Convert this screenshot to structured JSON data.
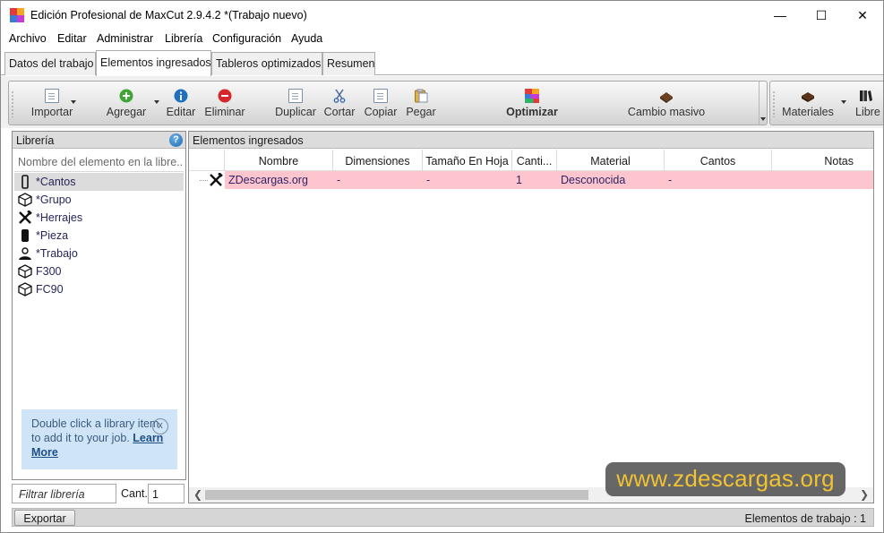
{
  "window": {
    "title": "Edición Profesional de MaxCut 2.9.4.2 *(Trabajo nuevo)",
    "minimize_glyph": "—",
    "maximize_glyph": "☐",
    "close_glyph": "✕"
  },
  "menu": [
    "Archivo",
    "Editar",
    "Administrar",
    "Librería",
    "Configuración",
    "Ayuda"
  ],
  "tabs": [
    {
      "label": "Datos del trabajo",
      "active": false
    },
    {
      "label": "Elementos ingresados",
      "active": true
    },
    {
      "label": "Tableros optimizados",
      "active": false
    },
    {
      "label": "Resumen",
      "active": false
    }
  ],
  "toolbar": {
    "importar": "Importar",
    "agregar": "Agregar",
    "editar": "Editar",
    "eliminar": "Eliminar",
    "duplicar": "Duplicar",
    "cortar": "Cortar",
    "copiar": "Copiar",
    "pegar": "Pegar",
    "optimizar": "Optimizar",
    "cambio_masivo": "Cambio masivo",
    "materiales": "Materiales",
    "libre": "Libre"
  },
  "library": {
    "title": "Librería",
    "help_glyph": "?",
    "search_placeholder": "Nombre del elemento en la libre...",
    "items": [
      {
        "label": "*Cantos",
        "icon": "edge-band-icon",
        "selected": true
      },
      {
        "label": "*Grupo",
        "icon": "group-icon",
        "selected": false
      },
      {
        "label": "*Herrajes",
        "icon": "hardware-tools-icon",
        "selected": false
      },
      {
        "label": "*Pieza",
        "icon": "piece-icon",
        "selected": false
      },
      {
        "label": "*Trabajo",
        "icon": "job-icon",
        "selected": false
      },
      {
        "label": "F300",
        "icon": "group-icon",
        "selected": false
      },
      {
        "label": "FC90",
        "icon": "group-icon",
        "selected": false
      }
    ],
    "info_text": "Double click a library item to add it to your job.",
    "info_link": "Learn More",
    "info_close_glyph": "x",
    "filter_placeholder": "Filtrar librería",
    "cant_label": "Cant.",
    "cant_value": "1"
  },
  "elements": {
    "title": "Elementos ingresados",
    "columns": [
      "Nombre",
      "Dimensiones",
      "Tamaño En Hoja",
      "Canti...",
      "Material",
      "Cantos",
      "Notas"
    ],
    "rows": [
      {
        "nombre": "ZDescargas.org",
        "dimensiones": "-",
        "tamano": "-",
        "cantidad": "1",
        "material": "Desconocida",
        "cantos": "-",
        "notas": ""
      }
    ]
  },
  "watermark": "www.zdescargas.org",
  "status": {
    "export_label": "Exportar",
    "count_text": "Elementos de trabajo :  1"
  },
  "colors": {
    "row_highlight": "#ffc5cf",
    "info_box": "#cfe4f6",
    "watermark_text": "#f1c232"
  }
}
